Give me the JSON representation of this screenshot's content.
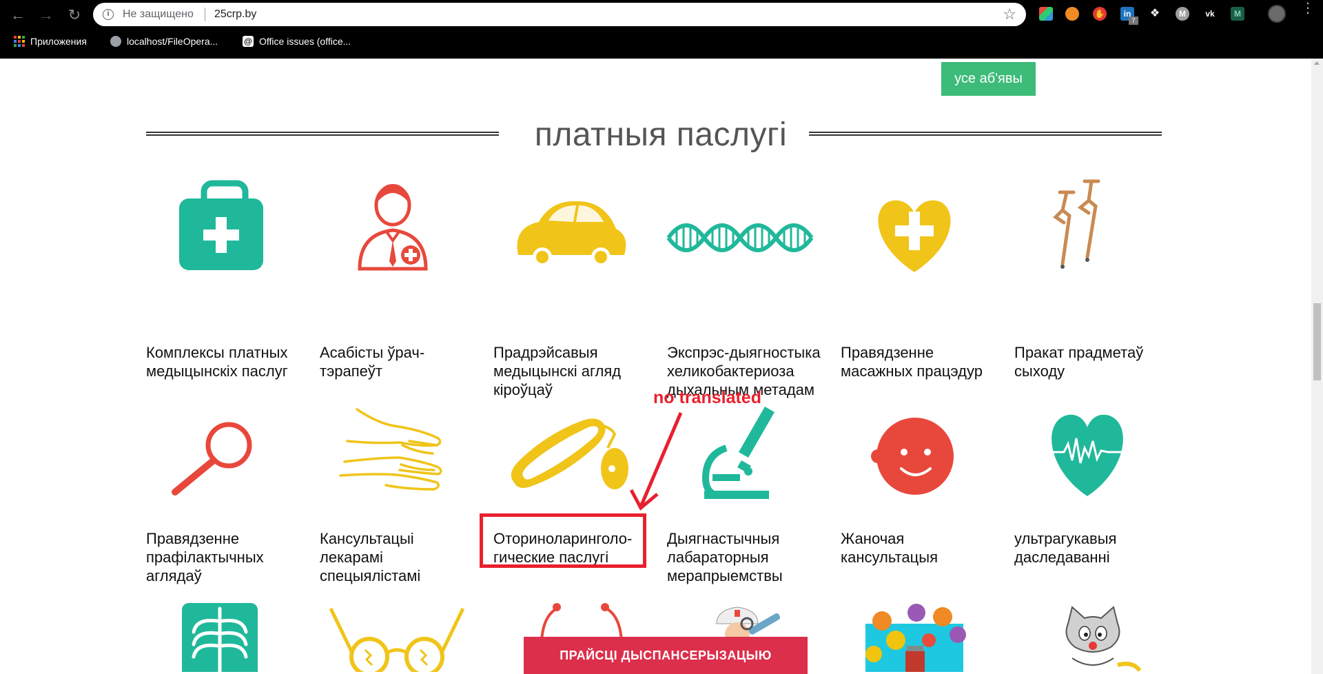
{
  "browser": {
    "security_label": "Не защищено",
    "url": "25crp.by",
    "bookmarks": [
      {
        "label": "Приложения",
        "icon": "apps-grid-icon"
      },
      {
        "label": "localhost/FileOpera...",
        "icon": "globe-icon"
      },
      {
        "label": "Office issues (office...",
        "icon": "at-sign-icon"
      }
    ],
    "extensions": [
      "colorful-bag-icon",
      "orange-ball-icon",
      "stop-hand-icon",
      "linkedin-icon",
      "puzzle-icon",
      "m-circle-icon",
      "vk-icon",
      "m-square-icon"
    ],
    "linkedin_badge": "7"
  },
  "page": {
    "all_ads_button": "усе аб'явы",
    "section_title": "платныя паслугі",
    "services": [
      {
        "label": "Комплексы платных медыцынскіх паслуг",
        "icon": "medical-kit-icon"
      },
      {
        "label": "Асабісты ўрач-тэрапеўт",
        "icon": "doctor-icon"
      },
      {
        "label": "Прадрэйсавыя медыцынскі агляд кіроўцаў",
        "icon": "car-icon"
      },
      {
        "label": "Экспрэс-дыягностыка хеликобактериоза дыхальным метадам",
        "icon": "dna-icon"
      },
      {
        "label": "Правядзенне масажных працэдур",
        "icon": "heart-cross-icon"
      },
      {
        "label": "Пракат прадметаў сыходу",
        "icon": "crutches-icon"
      },
      {
        "label": "Правядзенне прафілактычных аглядаў",
        "icon": "magnifier-icon"
      },
      {
        "label": "Кансультацыі лекарамі спецыялістамі",
        "icon": "hands-icon"
      },
      {
        "label": "Оториноларинголо-гические паслугі",
        "icon": "otoscope-icon"
      },
      {
        "label": "Дыягнастычныя лабараторныя мерапрыемствы",
        "icon": "microscope-icon"
      },
      {
        "label": "Жаночая кансультацыя",
        "icon": "baby-face-icon"
      },
      {
        "label": "ультрагукавыя даследаванні",
        "icon": "heart-pulse-icon"
      },
      {
        "label": "",
        "icon": "xray-icon"
      },
      {
        "label": "",
        "icon": "glasses-icon"
      },
      {
        "label": "",
        "icon": "stethoscope-icon"
      },
      {
        "label": "",
        "icon": "nurse-icon"
      },
      {
        "label": "",
        "icon": "pills-viruses-icon"
      },
      {
        "label": "",
        "icon": "cartoon-cat-icon"
      }
    ],
    "annotation": "no translated",
    "cta_button": "ПРАЙСЦІ ДЫСПАНСЕРЫЗАЦЫЮ"
  },
  "colors": {
    "teal": "#20b89b",
    "red": "#e8483c",
    "yellow": "#f0c419",
    "green_button": "#3dbb78",
    "cta": "#dc2f4b",
    "annotation_red": "#e8202e"
  }
}
